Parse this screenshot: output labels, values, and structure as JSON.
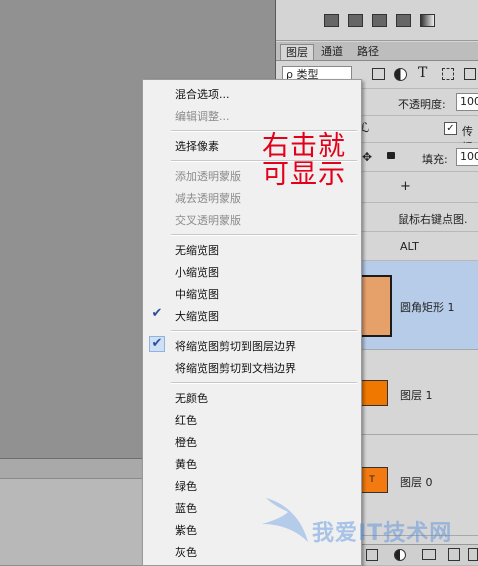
{
  "layers_panel": {
    "tabs": [
      "图层",
      "通道",
      "路径"
    ],
    "filter_label": "ρ 类型",
    "opacity_label": "不透明度:",
    "opacity_value": "100",
    "fill_label": "填充:",
    "fill_value": "100",
    "propagate_label": "传播",
    "add_label": "+",
    "hint_text": "鼠标右键点图.",
    "alt_label": "ALT",
    "layers": [
      {
        "name": "圆角矩形 1",
        "thumb_color": "#e6a06a",
        "selected": true
      },
      {
        "name": "图层 1",
        "thumb_color": "#f07800",
        "selected": false
      },
      {
        "name": "图层 0",
        "thumb_color": "#f27a10",
        "thumb_text": "T",
        "selected": false
      }
    ]
  },
  "context_menu": {
    "items": [
      {
        "label": "混合选项...",
        "disabled": false
      },
      {
        "label": "编辑调整...",
        "disabled": true
      },
      {
        "label": "选择像素",
        "disabled": false
      },
      {
        "label": "添加透明蒙版",
        "disabled": true
      },
      {
        "label": "减去透明蒙版",
        "disabled": true
      },
      {
        "label": "交叉透明蒙版",
        "disabled": true
      },
      {
        "label": "无缩览图",
        "disabled": false
      },
      {
        "label": "小缩览图",
        "disabled": false
      },
      {
        "label": "中缩览图",
        "disabled": false
      },
      {
        "label": "大缩览图",
        "disabled": false,
        "checked": true
      },
      {
        "label": "将缩览图剪切到图层边界",
        "disabled": false,
        "checked": true
      },
      {
        "label": "将缩览图剪切到文档边界",
        "disabled": false
      },
      {
        "label": "无颜色",
        "disabled": false
      },
      {
        "label": "红色",
        "disabled": false
      },
      {
        "label": "橙色",
        "disabled": false
      },
      {
        "label": "黄色",
        "disabled": false
      },
      {
        "label": "绿色",
        "disabled": false
      },
      {
        "label": "蓝色",
        "disabled": false
      },
      {
        "label": "紫色",
        "disabled": false
      },
      {
        "label": "灰色",
        "disabled": false
      }
    ]
  },
  "annotation": {
    "line1": "右击就",
    "line2": "可显示"
  },
  "watermark": "我爱IT技术网"
}
